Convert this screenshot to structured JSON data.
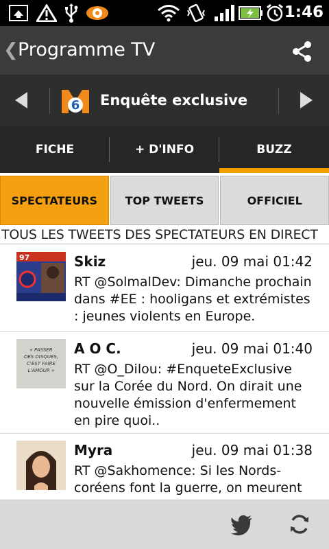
{
  "status_bar": {
    "time": "1:46",
    "icons": [
      "screenshot-icon",
      "warning-icon",
      "usb-icon",
      "eye-icon",
      "wifi-icon",
      "vibrate-icon",
      "signal-icon",
      "battery-icon",
      "alarm-icon"
    ]
  },
  "header": {
    "back_glyph": "❮",
    "title": "Programme TV"
  },
  "channel": {
    "program": "Enquête exclusive",
    "logo_text": "6"
  },
  "main_tabs": [
    {
      "label": "FICHE"
    },
    {
      "label": "+ D'INFO"
    },
    {
      "label": "BUZZ"
    }
  ],
  "sub_tabs": [
    {
      "label": "SPECTATEURS"
    },
    {
      "label": "TOP TWEETS"
    },
    {
      "label": "OFFICIEL"
    }
  ],
  "section_title": "TOUS LES TWEETS DES SPECTATEURS EN DIRECT",
  "tweets": [
    {
      "name": "Skiz",
      "date": "jeu. 09 mai 01:42",
      "text": "RT @SolmalDev: Dimanche prochain dans #EE : hooligans et extrémistes : jeunes violents en Europe."
    },
    {
      "name": "A O C.",
      "date": "jeu. 09 mai 01:40",
      "text": "RT @O_Dilou: #EnqueteExclusive sur la Corée du Nord. On dirait une nouvelle émission d'enfermement en pire quoi.."
    },
    {
      "name": "Myra",
      "date": "jeu. 09 mai 01:38",
      "text": "RT @Sakhomence: Si les Nords-coréens font la guerre, on meurent"
    }
  ],
  "avatar_texts": {
    "skiz_badge": "97",
    "aoc_quote": "« PASSER DES DISQUES, C'EST FAIRE L'AMOUR »"
  },
  "colors": {
    "accent": "#f3a000",
    "header_bg": "#3b3b3b",
    "tabs_bg": "#262626"
  }
}
